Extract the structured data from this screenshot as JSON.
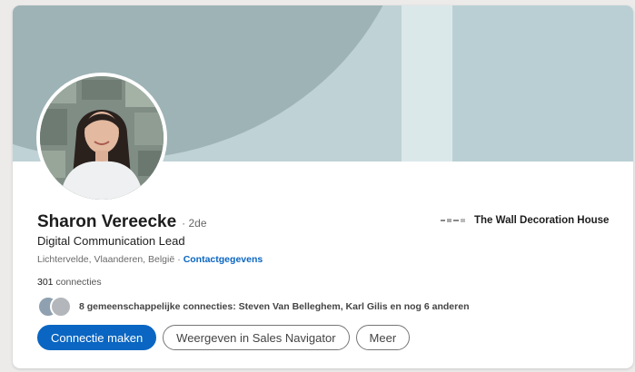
{
  "profile": {
    "name": "Sharon Vereecke",
    "degree": "· 2de",
    "headline": "Digital Communication Lead",
    "location": "Lichtervelde, Vlaanderen, België",
    "separator": "·",
    "contact_link": "Contactgegevens",
    "connections_count": "301",
    "connections_label": "connecties",
    "mutual_text": "8 gemeenschappelijke connecties: Steven Van Belleghem, Karl Gilis en nog 6 anderen",
    "company": "The Wall Decoration House"
  },
  "actions": {
    "connect_label": "Connectie maken",
    "sales_navigator_label": "Weergeven in Sales Navigator",
    "more_label": "Meer"
  },
  "colors": {
    "accent": "#0a66c2",
    "banner": "#9eb3b6"
  }
}
